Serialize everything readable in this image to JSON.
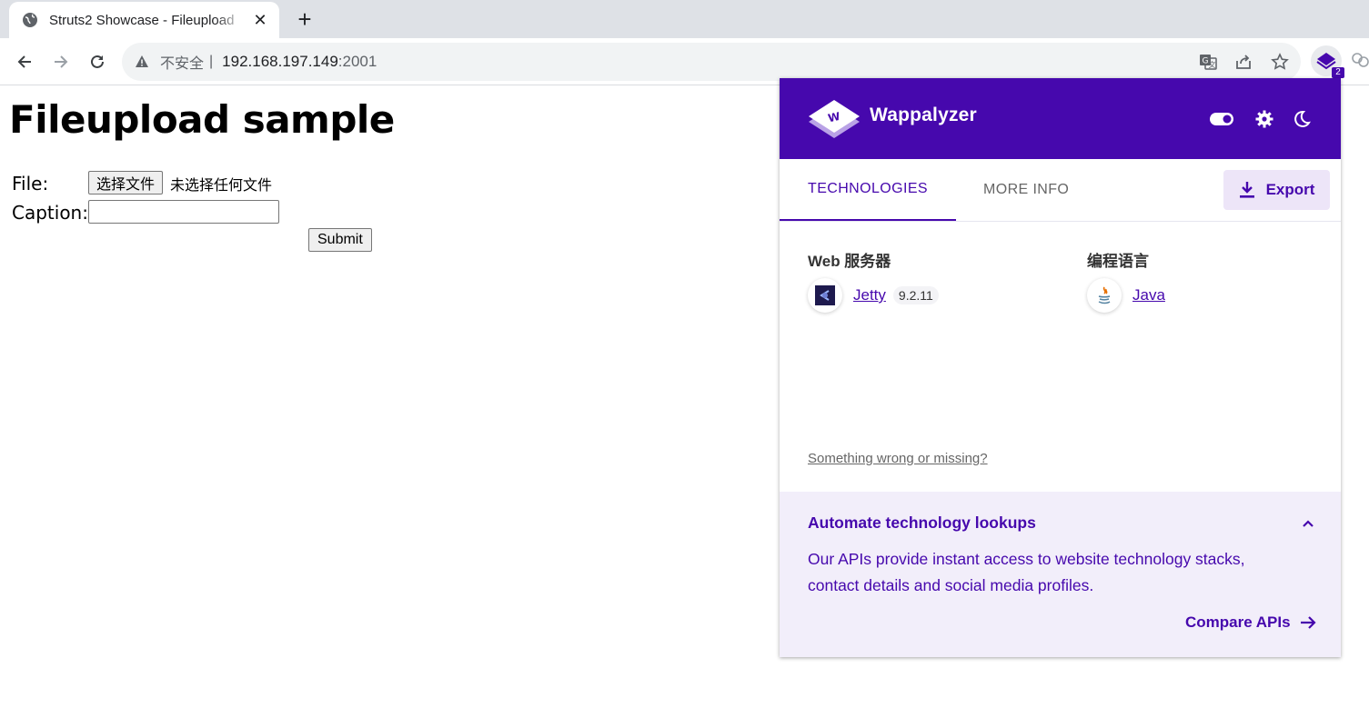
{
  "browser": {
    "tab_title": "Struts2 Showcase - Fileupload",
    "omnibox": {
      "security_label": "不安全",
      "separator": "|",
      "host": "192.168.197.149",
      "port": ":2001"
    },
    "extension_badge": "2"
  },
  "page": {
    "heading": "Fileupload sample",
    "file_label": "File:",
    "file_button": "选择文件",
    "file_status": "未选择任何文件",
    "caption_label": "Caption:",
    "caption_value": "",
    "submit_label": "Submit"
  },
  "wappalyzer": {
    "brand": "Wappalyzer",
    "tabs": [
      "TECHNOLOGIES",
      "MORE INFO"
    ],
    "export_label": "Export",
    "categories": [
      {
        "name": "Web 服务器",
        "tech": {
          "name": "Jetty",
          "version": "9.2.11",
          "icon": "jetty-icon"
        }
      },
      {
        "name": "编程语言",
        "tech": {
          "name": "Java",
          "version": "",
          "icon": "java-icon"
        }
      }
    ],
    "wrong_link": "Something wrong or missing?",
    "footer": {
      "title": "Automate technology lookups",
      "text": "Our APIs provide instant access to website technology stacks, contact details and social media profiles.",
      "cta": "Compare APIs"
    },
    "colors": {
      "accent": "#4608ad",
      "footer_bg": "#f2eefa"
    }
  }
}
